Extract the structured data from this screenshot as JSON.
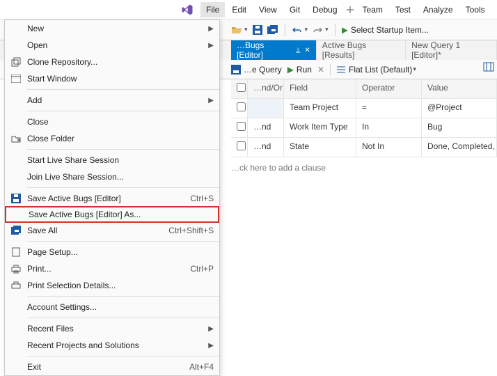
{
  "menubar": {
    "file": "File",
    "edit": "Edit",
    "view": "View",
    "git": "Git",
    "debug": "Debug",
    "team": "Team",
    "test": "Test",
    "analyze": "Analyze",
    "tools": "Tools"
  },
  "toolbar": {
    "startup": "Select Startup Item..."
  },
  "tabs": {
    "active": "…Bugs [Editor]",
    "t1": "Active Bugs [Results]",
    "t2": "New Query 1 [Editor]*"
  },
  "querybar": {
    "save_hint": "…e Query",
    "run": "Run",
    "view_mode": "Flat List (Default)"
  },
  "grid": {
    "headers": {
      "chk": "",
      "andor": "…nd/Or",
      "field": "Field",
      "operator": "Operator",
      "value": "Value"
    },
    "rows": [
      {
        "chk": "",
        "andor": "",
        "field": "Team Project",
        "operator": "=",
        "value": "@Project"
      },
      {
        "chk": "",
        "andor": "…nd",
        "field": "Work Item Type",
        "operator": "In",
        "value": "Bug"
      },
      {
        "chk": "",
        "andor": "…nd",
        "field": "State",
        "operator": "Not In",
        "value": "Done, Completed,"
      }
    ],
    "hint": "…ck here to add a clause"
  },
  "filemenu": {
    "new": "New",
    "open": "Open",
    "clone": "Clone Repository...",
    "start_window": "Start Window",
    "add": "Add",
    "close": "Close",
    "close_folder": "Close Folder",
    "start_live": "Start Live Share Session",
    "join_live": "Join Live Share Session...",
    "save": "Save Active Bugs [Editor]",
    "save_short": "Ctrl+S",
    "save_as": "Save Active Bugs [Editor] As...",
    "save_all": "Save All",
    "save_all_short": "Ctrl+Shift+S",
    "page_setup": "Page Setup...",
    "print": "Print...",
    "print_short": "Ctrl+P",
    "print_sel": "Print Selection Details...",
    "account": "Account Settings...",
    "recent_files": "Recent Files",
    "recent_proj": "Recent Projects and Solutions",
    "exit": "Exit",
    "exit_short": "Alt+F4"
  }
}
